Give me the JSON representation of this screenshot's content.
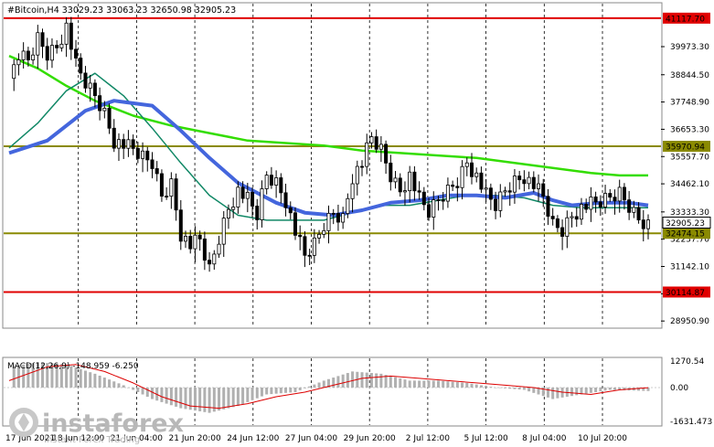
{
  "header": {
    "symbol_line": "#Bitcoin,H4  33029.23 33063.23 32650.98 32905.23"
  },
  "macd": {
    "label": "MACD(12,26,9) -148.959 -6.250",
    "scale_labels": [
      "1270.54",
      "0.00",
      "-1631.473"
    ]
  },
  "watermark": {
    "brand": "instaforex",
    "tagline": "Instant Forex Trading"
  },
  "colors": {
    "red_level": "#e00000",
    "olive_level": "#8a8a00",
    "ma_green": "#33dd00",
    "ma_blue": "#4466dd",
    "ma_teal": "#118866",
    "macd_signal": "#dd0000",
    "macd_hist": "#b0b0b0"
  },
  "chart_data": {
    "type": "candlestick",
    "price_axis_ticks": [
      "39973.30",
      "38844.50",
      "37748.90",
      "36653.30",
      "35557.70",
      "34462.10",
      "33333.30",
      "32237.70",
      "31142.10",
      "30046.50",
      "28950.90"
    ],
    "price_range": [
      28700,
      41700
    ],
    "time_labels": [
      "17 Jun 2021",
      "18 Jun 12:00",
      "21 Jun 04:00",
      "21 Jun 20:00",
      "24 Jun 12:00",
      "27 Jun 04:00",
      "29 Jun 20:00",
      "2 Jul 12:00",
      "5 Jul 12:00",
      "8 Jul 04:00",
      "10 Jul 20:00"
    ],
    "levels": [
      {
        "label": "41117.70",
        "value": 41117.7,
        "color": "red"
      },
      {
        "label": "35970.94",
        "value": 35970.94,
        "color": "olive"
      },
      {
        "label": "32474.15",
        "value": 32474.15,
        "color": "olive"
      },
      {
        "label": "30114.87",
        "value": 30114.87,
        "color": "red"
      }
    ],
    "current_price": {
      "label": "32905.23",
      "value": 32905.23
    },
    "close_path": [
      [
        0,
        38700
      ],
      [
        2,
        39600
      ],
      [
        4,
        39400
      ],
      [
        6,
        40300
      ],
      [
        8,
        39700
      ],
      [
        10,
        40000
      ],
      [
        12,
        40800
      ],
      [
        14,
        39200
      ],
      [
        16,
        38500
      ],
      [
        18,
        38000
      ],
      [
        20,
        37300
      ],
      [
        22,
        36200
      ],
      [
        24,
        36000
      ],
      [
        26,
        35800
      ],
      [
        28,
        35500
      ],
      [
        30,
        35300
      ],
      [
        32,
        34000
      ],
      [
        34,
        34500
      ],
      [
        36,
        32500
      ],
      [
        38,
        32000
      ],
      [
        40,
        32200
      ],
      [
        42,
        31000
      ],
      [
        44,
        32300
      ],
      [
        46,
        33500
      ],
      [
        48,
        34200
      ],
      [
        50,
        33800
      ],
      [
        52,
        33200
      ],
      [
        54,
        34800
      ],
      [
        56,
        34500
      ],
      [
        58,
        33800
      ],
      [
        60,
        32500
      ],
      [
        62,
        31500
      ],
      [
        64,
        32000
      ],
      [
        66,
        32800
      ],
      [
        68,
        33300
      ],
      [
        70,
        33100
      ],
      [
        72,
        34800
      ],
      [
        74,
        35300
      ],
      [
        76,
        36300
      ],
      [
        78,
        35800
      ],
      [
        80,
        34800
      ],
      [
        82,
        34200
      ],
      [
        84,
        34800
      ],
      [
        86,
        33800
      ],
      [
        88,
        33300
      ],
      [
        90,
        33800
      ],
      [
        92,
        34200
      ],
      [
        94,
        34600
      ],
      [
        96,
        35400
      ],
      [
        98,
        34800
      ],
      [
        100,
        34000
      ],
      [
        102,
        33600
      ],
      [
        104,
        34200
      ],
      [
        106,
        34600
      ],
      [
        108,
        34800
      ],
      [
        110,
        34400
      ],
      [
        112,
        33900
      ],
      [
        114,
        32800
      ],
      [
        116,
        32600
      ],
      [
        118,
        33200
      ],
      [
        120,
        33500
      ],
      [
        122,
        33600
      ],
      [
        124,
        33700
      ],
      [
        126,
        33900
      ],
      [
        128,
        34100
      ],
      [
        130,
        33600
      ],
      [
        132,
        33100
      ],
      [
        134,
        32905
      ]
    ],
    "ma_fast_blue": [
      [
        0,
        35700
      ],
      [
        8,
        36200
      ],
      [
        16,
        37400
      ],
      [
        22,
        37800
      ],
      [
        30,
        37600
      ],
      [
        36,
        36600
      ],
      [
        42,
        35500
      ],
      [
        48,
        34500
      ],
      [
        56,
        33700
      ],
      [
        62,
        33300
      ],
      [
        68,
        33200
      ],
      [
        74,
        33400
      ],
      [
        80,
        33700
      ],
      [
        86,
        33800
      ],
      [
        92,
        34000
      ],
      [
        98,
        34000
      ],
      [
        104,
        33900
      ],
      [
        110,
        34100
      ],
      [
        114,
        33800
      ],
      [
        118,
        33600
      ],
      [
        124,
        33700
      ],
      [
        130,
        33700
      ],
      [
        134,
        33600
      ]
    ],
    "ma_slow_green": [
      [
        0,
        39600
      ],
      [
        6,
        39100
      ],
      [
        12,
        38400
      ],
      [
        18,
        37800
      ],
      [
        26,
        37200
      ],
      [
        34,
        36800
      ],
      [
        42,
        36500
      ],
      [
        50,
        36200
      ],
      [
        58,
        36100
      ],
      [
        66,
        36000
      ],
      [
        74,
        35800
      ],
      [
        82,
        35700
      ],
      [
        90,
        35600
      ],
      [
        98,
        35500
      ],
      [
        106,
        35300
      ],
      [
        114,
        35100
      ],
      [
        122,
        34900
      ],
      [
        128,
        34800
      ],
      [
        134,
        34800
      ]
    ],
    "ma_mid_teal": [
      [
        0,
        35900
      ],
      [
        6,
        36900
      ],
      [
        12,
        38200
      ],
      [
        18,
        38900
      ],
      [
        24,
        38000
      ],
      [
        30,
        36700
      ],
      [
        36,
        35300
      ],
      [
        42,
        34000
      ],
      [
        48,
        33200
      ],
      [
        54,
        33000
      ],
      [
        60,
        33000
      ],
      [
        66,
        33000
      ],
      [
        72,
        33300
      ],
      [
        78,
        33600
      ],
      [
        84,
        33600
      ],
      [
        90,
        33800
      ],
      [
        96,
        34000
      ],
      [
        102,
        34000
      ],
      [
        108,
        33900
      ],
      [
        114,
        33600
      ],
      [
        120,
        33500
      ],
      [
        126,
        33500
      ],
      [
        134,
        33500
      ]
    ],
    "macd_histogram": [
      [
        0,
        900
      ],
      [
        6,
        1100
      ],
      [
        12,
        1000
      ],
      [
        18,
        600
      ],
      [
        24,
        100
      ],
      [
        30,
        -500
      ],
      [
        36,
        -900
      ],
      [
        42,
        -1100
      ],
      [
        48,
        -800
      ],
      [
        54,
        -300
      ],
      [
        60,
        -200
      ],
      [
        66,
        300
      ],
      [
        72,
        700
      ],
      [
        78,
        600
      ],
      [
        84,
        300
      ],
      [
        90,
        300
      ],
      [
        96,
        200
      ],
      [
        102,
        0
      ],
      [
        108,
        -100
      ],
      [
        114,
        -500
      ],
      [
        120,
        -300
      ],
      [
        126,
        -100
      ],
      [
        134,
        -150
      ]
    ],
    "macd_signal": [
      [
        0,
        300
      ],
      [
        8,
        900
      ],
      [
        14,
        1000
      ],
      [
        20,
        700
      ],
      [
        26,
        200
      ],
      [
        32,
        -400
      ],
      [
        38,
        -800
      ],
      [
        44,
        -900
      ],
      [
        50,
        -700
      ],
      [
        56,
        -400
      ],
      [
        62,
        -200
      ],
      [
        68,
        100
      ],
      [
        74,
        400
      ],
      [
        80,
        500
      ],
      [
        86,
        400
      ],
      [
        92,
        300
      ],
      [
        98,
        200
      ],
      [
        104,
        100
      ],
      [
        110,
        0
      ],
      [
        116,
        -200
      ],
      [
        122,
        -300
      ],
      [
        128,
        -100
      ],
      [
        134,
        -6
      ]
    ],
    "macd_range": [
      -1631.473,
      1270.54
    ]
  }
}
